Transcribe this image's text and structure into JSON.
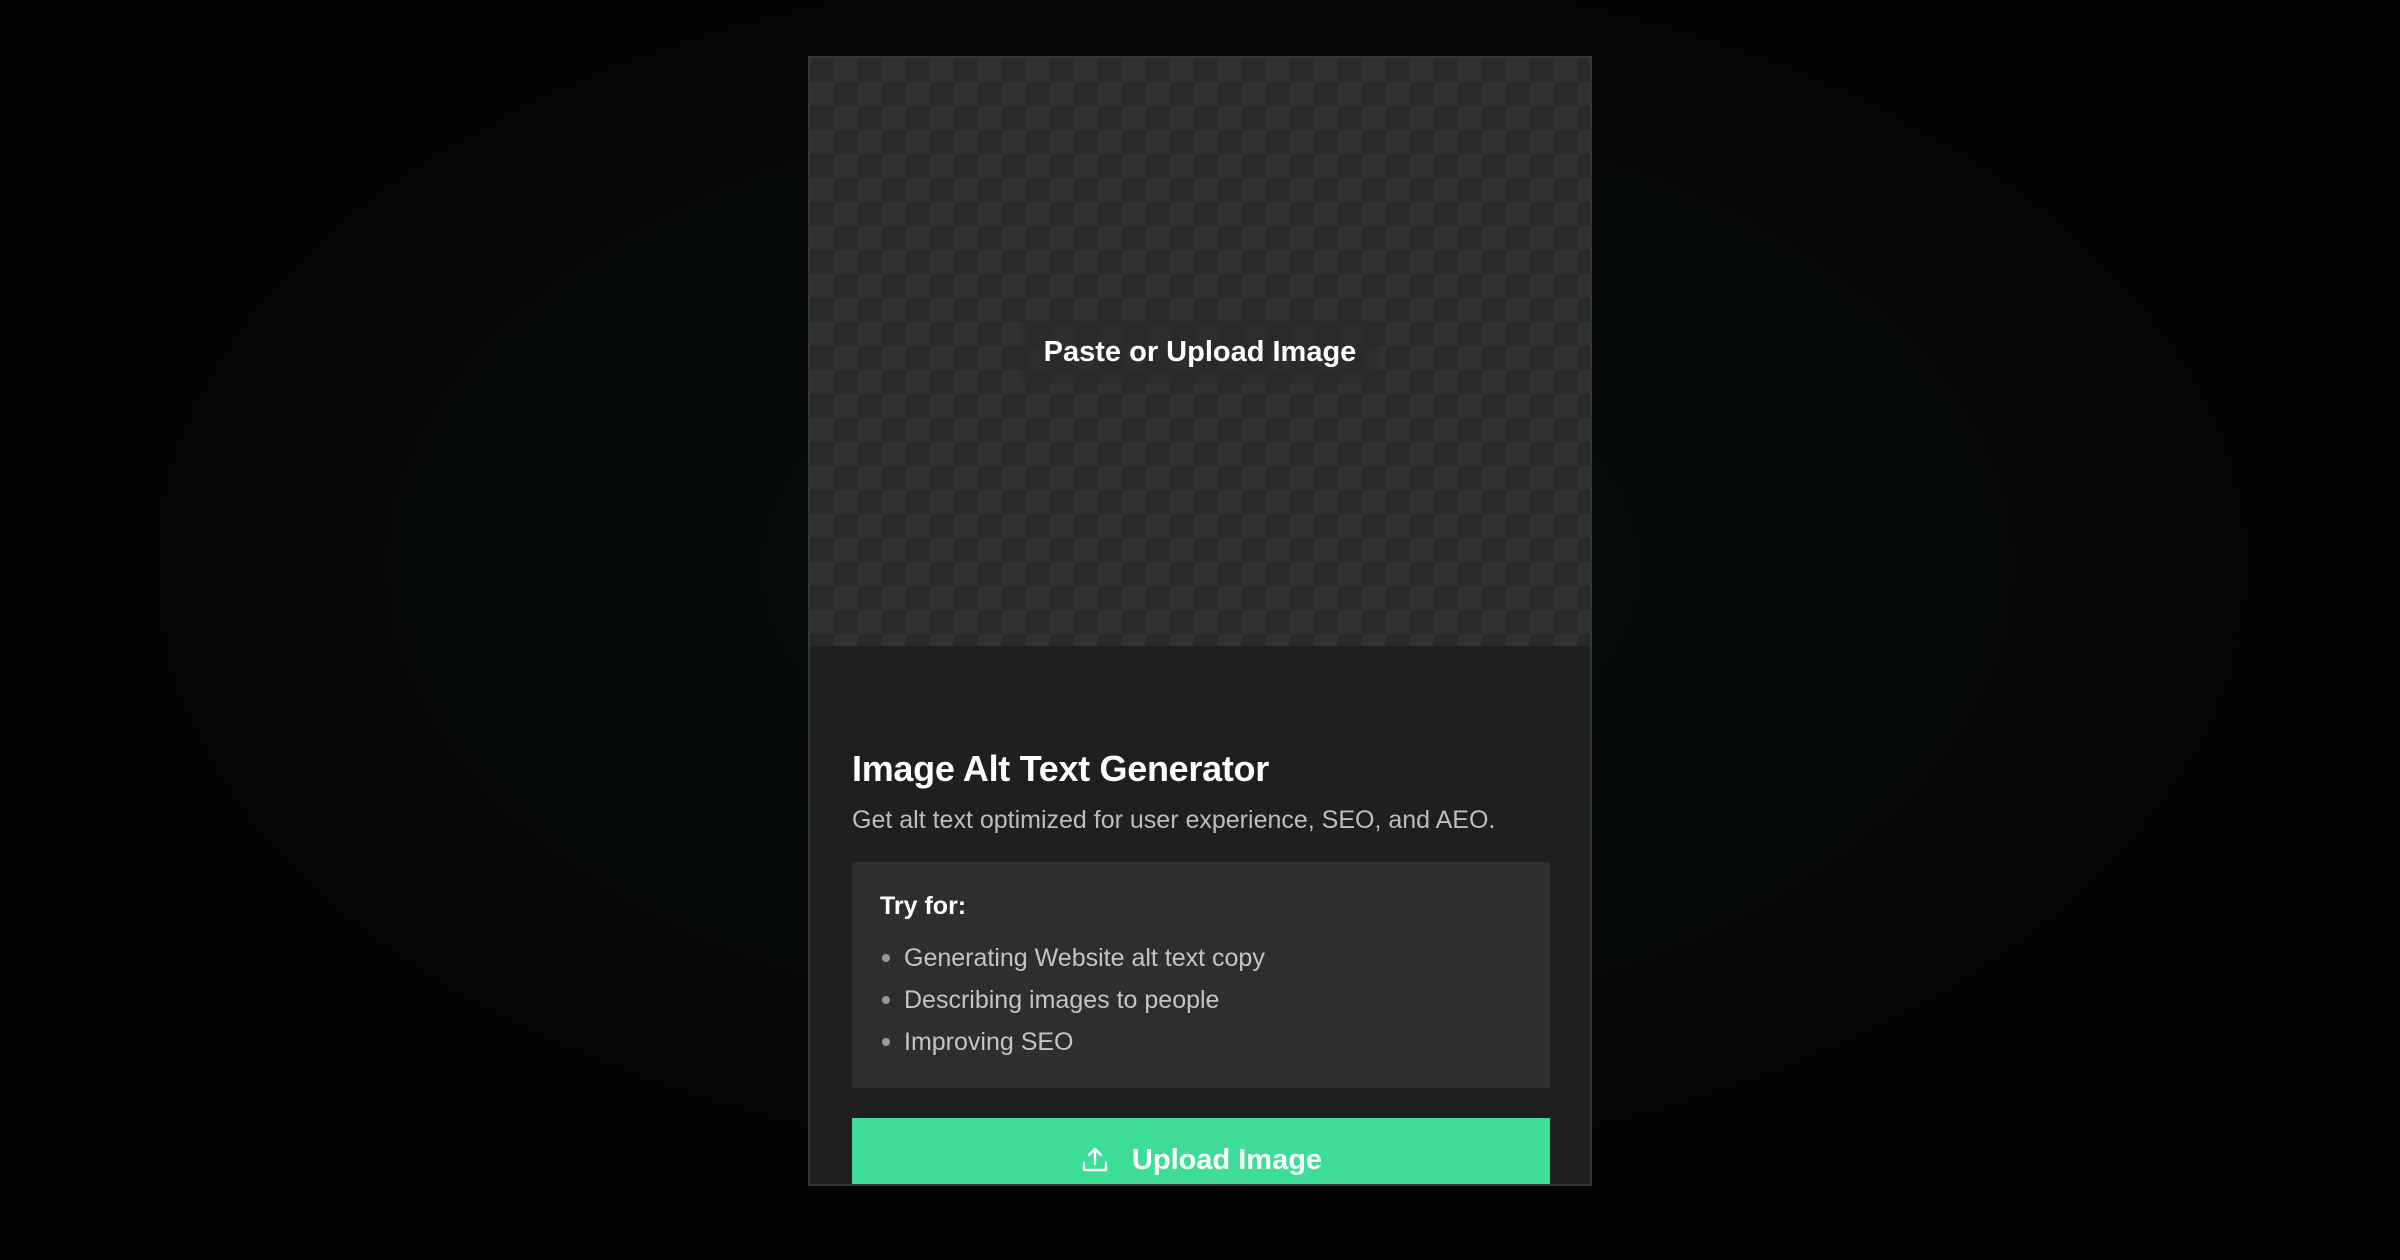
{
  "dropzone": {
    "label": "Paste or Upload Image"
  },
  "header": {
    "title": "Image Alt Text Generator",
    "subtitle": "Get alt text optimized for user experience, SEO, and AEO."
  },
  "tips": {
    "heading": "Try for:",
    "items": [
      {
        "label": "Generating Website alt text copy"
      },
      {
        "label": "Describing images to people"
      },
      {
        "label": "Improving SEO"
      }
    ]
  },
  "upload_button": {
    "label": "Upload Image",
    "icon": "upload-icon"
  },
  "colors": {
    "accent": "#3ddc97",
    "card": "#1f1f1f",
    "panel": "#2e2e2e"
  }
}
